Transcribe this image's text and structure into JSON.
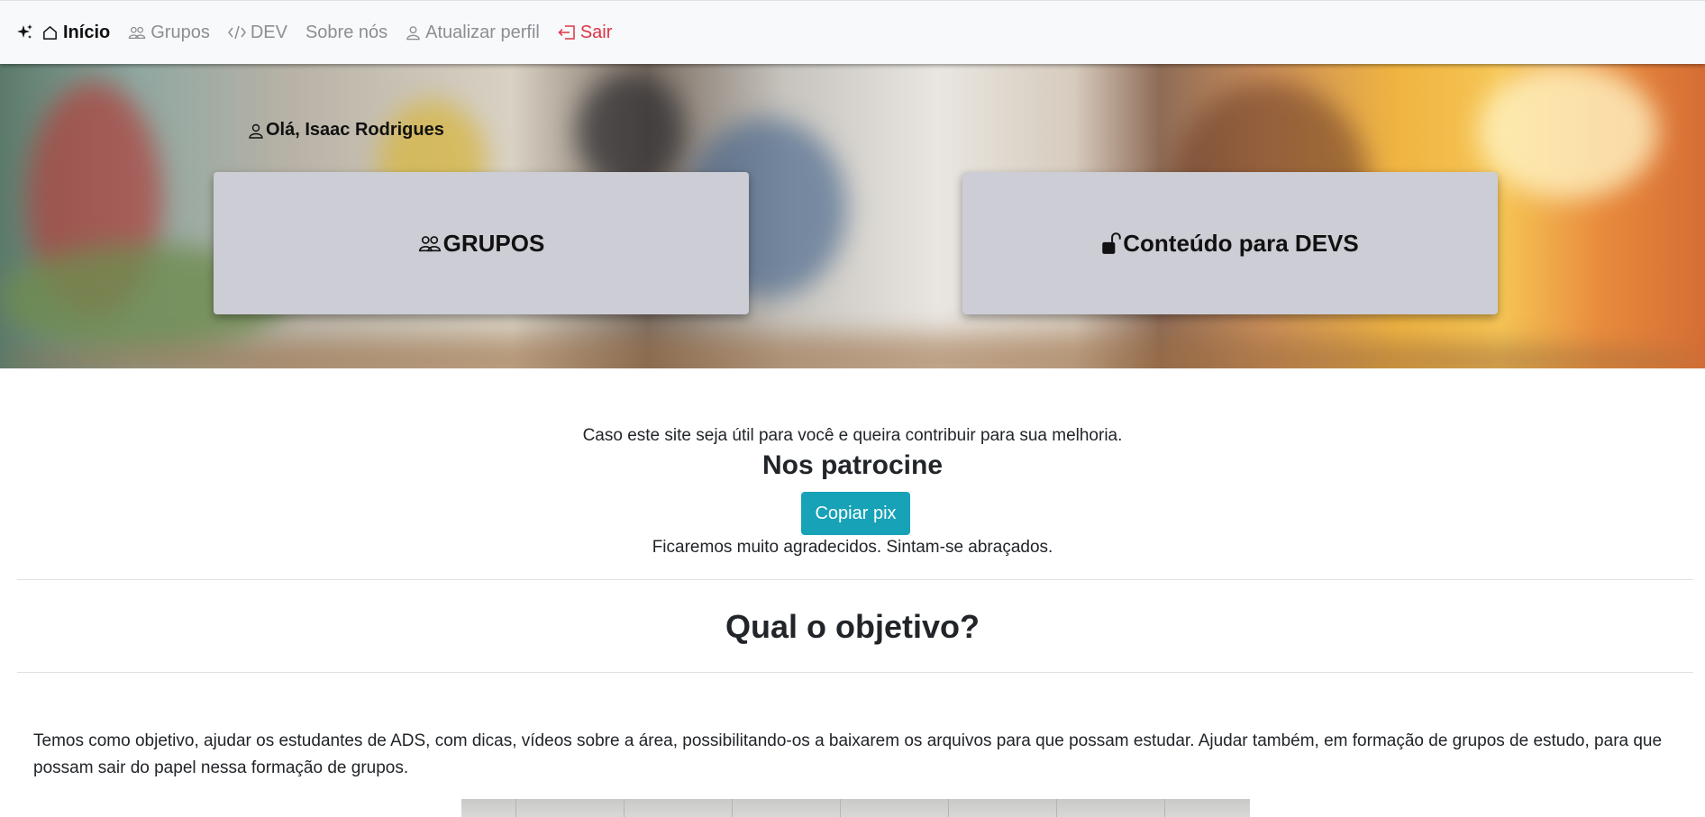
{
  "nav": {
    "items": [
      {
        "label": "Início",
        "icon": "home-icon",
        "active": true
      },
      {
        "label": "Grupos",
        "icon": "people-icon"
      },
      {
        "label": "DEV",
        "icon": "code-icon"
      },
      {
        "label": "Sobre nós",
        "icon": ""
      },
      {
        "label": "Atualizar perfil",
        "icon": "person-icon"
      },
      {
        "label": "Sair",
        "icon": "logout-icon",
        "color": "#dc3545"
      }
    ]
  },
  "hero": {
    "greeting": "Olá, Isaac Rodrigues",
    "cards": [
      {
        "label": "GRUPOS",
        "icon": "people-icon"
      },
      {
        "label": "Conteúdo para DEVS",
        "icon": "unlock-icon"
      }
    ]
  },
  "sponsor": {
    "intro": "Caso este site seja útil para você e queira contribuir para sua melhoria.",
    "title": "Nos patrocine",
    "button": "Copiar pix",
    "thanks": "Ficaremos muito agradecidos. Sintam-se abraçados."
  },
  "objective": {
    "title": "Qual o objetivo?",
    "text": "Temos como objetivo, ajudar os estudantes de ADS, com dicas, vídeos sobre a área, possibilitando-os a baixarem os arquivos para que possam estudar. Ajudar também, em formação de grupos de estudo, para que possam sair do papel nessa formação de grupos."
  },
  "colors": {
    "accent": "#17a2b8",
    "danger": "#dc3545",
    "card": "#cdcdd6",
    "navbar": "#f8f9fa"
  }
}
